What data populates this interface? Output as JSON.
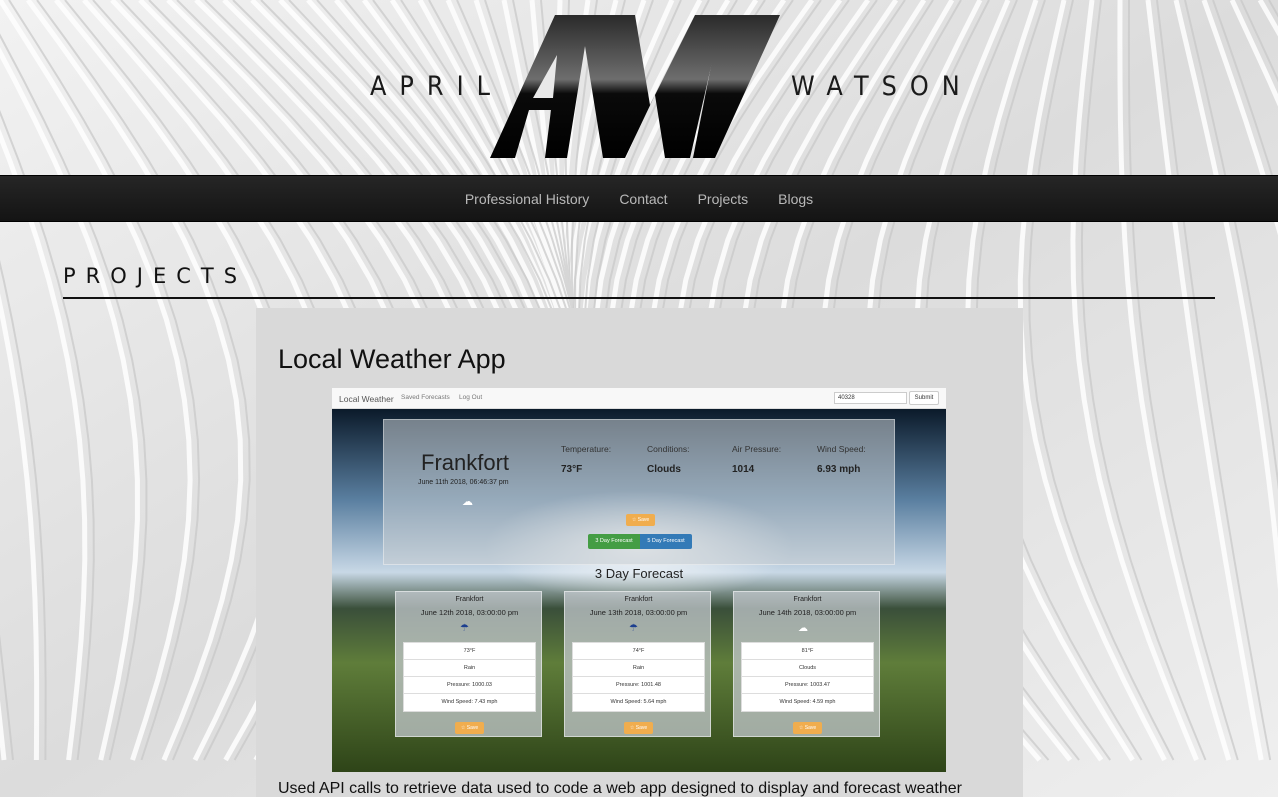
{
  "logo": {
    "first": "APRIL",
    "last": "WATSON",
    "monogram": "AW"
  },
  "nav": {
    "items": [
      {
        "label": "Professional History"
      },
      {
        "label": "Contact"
      },
      {
        "label": "Projects"
      },
      {
        "label": "Blogs"
      }
    ]
  },
  "page": {
    "section_title": "PROJECTS"
  },
  "project": {
    "title": "Local Weather App",
    "description": "Used API calls to retrieve data used to code a web app designed to display and forecast weather",
    "screenshot": {
      "brand": "Local Weather",
      "links": [
        "Saved Forecasts",
        "Log Out"
      ],
      "search_value": "40328",
      "submit_label": "Submit",
      "city": "Frankfort",
      "date": "June 11th 2018, 06:46:37 pm",
      "metrics": [
        {
          "label": "Temperature:",
          "value": "73°F"
        },
        {
          "label": "Conditions:",
          "value": "Clouds"
        },
        {
          "label": "Air Pressure:",
          "value": "1014"
        },
        {
          "label": "Wind Speed:",
          "value": "6.93 mph"
        }
      ],
      "save_label": "☆ Save",
      "btn_3day": "3 Day Forecast",
      "btn_5day": "5 Day Forecast",
      "forecast_heading": "3 Day Forecast",
      "forecasts": [
        {
          "city": "Frankfort",
          "date": "June 12th 2018, 03:00:00 pm",
          "icon": "rain-icon",
          "temp": "73°F",
          "cond": "Rain",
          "pressure": "Pressure: 1000.03",
          "wind": "Wind Speed: 7.43 mph"
        },
        {
          "city": "Frankfort",
          "date": "June 13th 2018, 03:00:00 pm",
          "icon": "rain-icon",
          "temp": "74°F",
          "cond": "Rain",
          "pressure": "Pressure: 1001.48",
          "wind": "Wind Speed: 5.64 mph"
        },
        {
          "city": "Frankfort",
          "date": "June 14th 2018, 03:00:00 pm",
          "icon": "cloud-icon",
          "temp": "81°F",
          "cond": "Clouds",
          "pressure": "Pressure: 1003.47",
          "wind": "Wind Speed: 4.59 mph"
        }
      ]
    }
  },
  "colors": {
    "navbar": "#1c1c1c",
    "nav_text": "#b9b9b9",
    "save": "#f0ad4e",
    "green": "#449d44",
    "blue": "#337ab7"
  }
}
